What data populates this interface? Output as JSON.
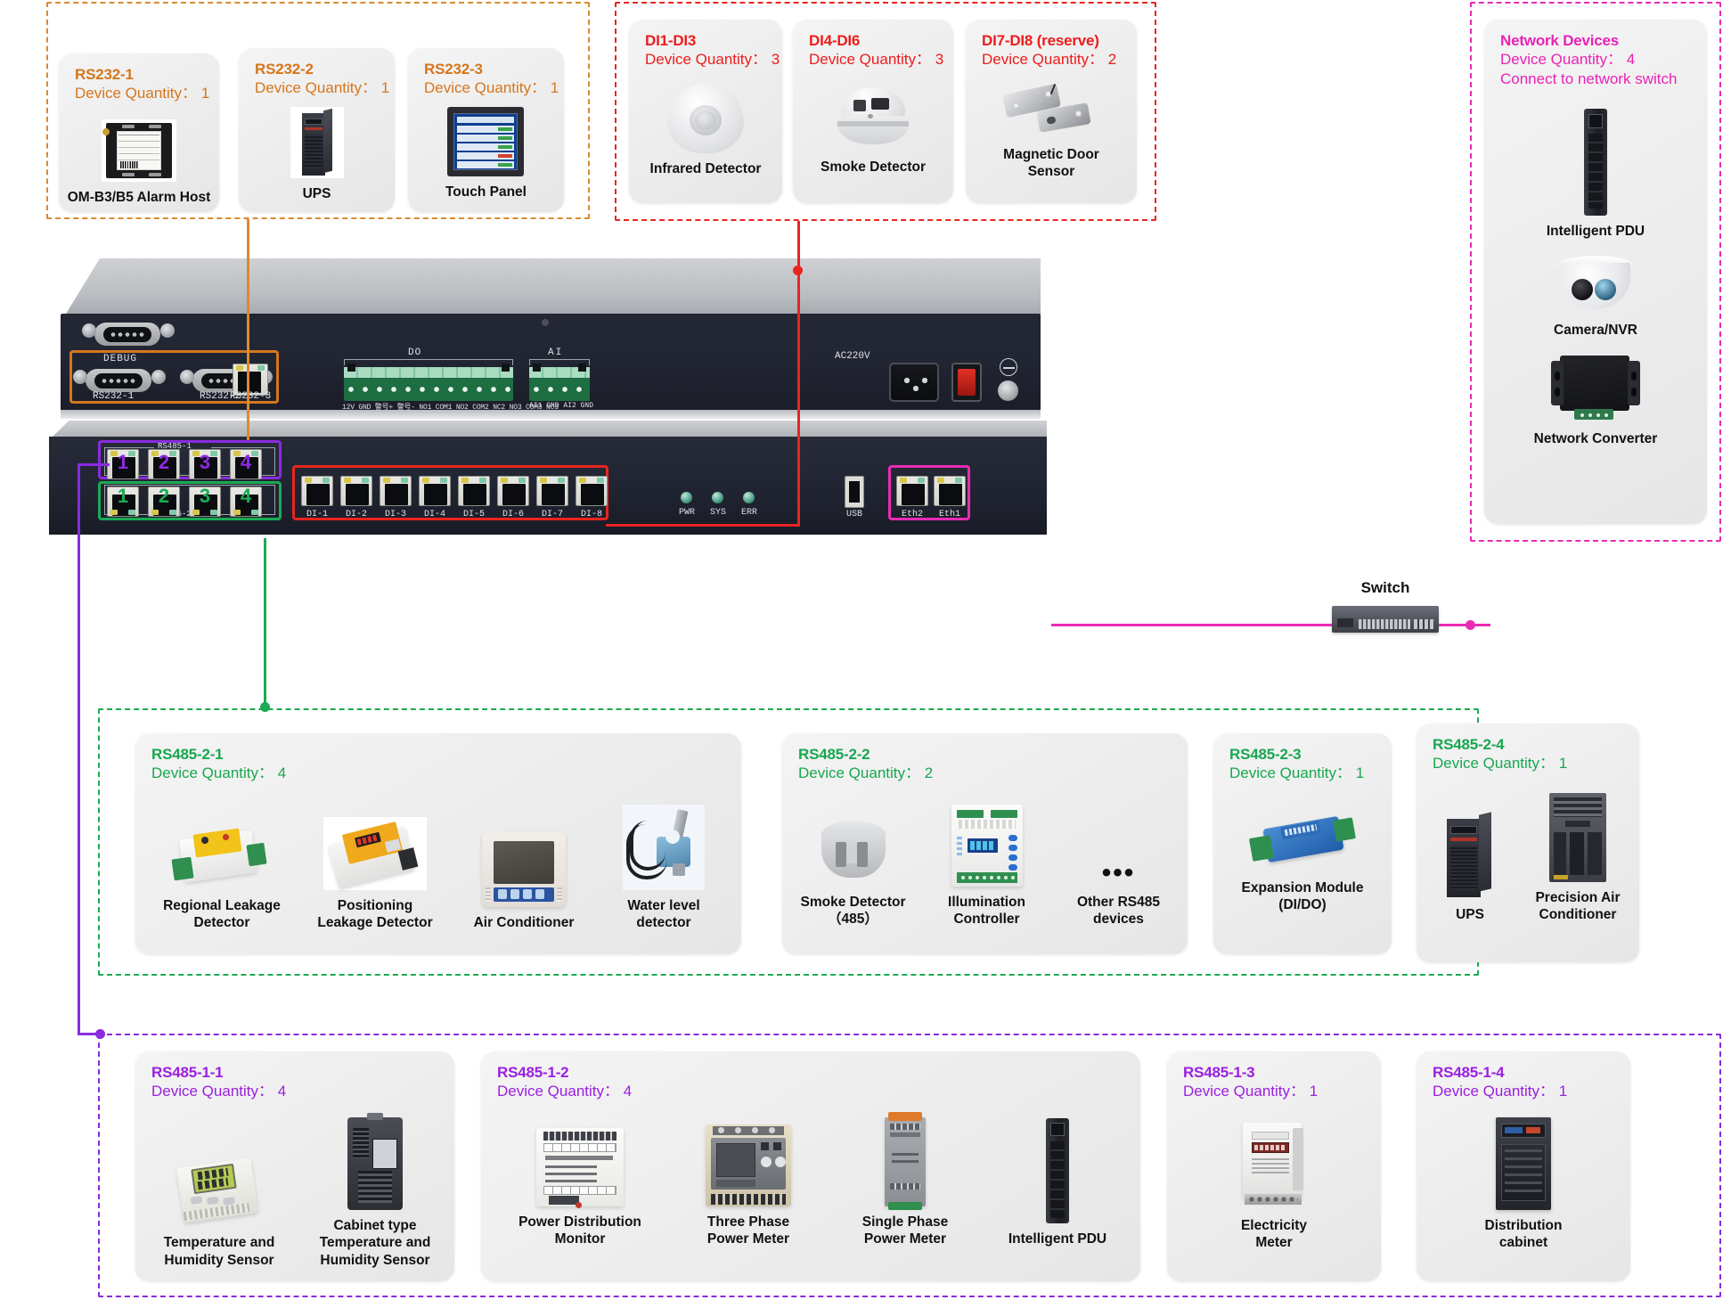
{
  "groups": {
    "rs232": {
      "color": "#d5761d"
    },
    "di": {
      "color": "#ee1c1c"
    },
    "network": {
      "color": "#ea22b6"
    },
    "rs485_2": {
      "color": "#17a74f"
    },
    "rs485_1": {
      "color": "#9b1fe0"
    }
  },
  "qty_label": "Device Quantity：",
  "rs232_cards": [
    {
      "title": "RS232-1",
      "qty": "Device Quantity： 1",
      "items": [
        {
          "label": "OM-B3/B5 Alarm Host",
          "icon": "alarm-host-image"
        }
      ]
    },
    {
      "title": "RS232-2",
      "qty": "Device Quantity： 1",
      "items": [
        {
          "label": "UPS",
          "icon": "ups-image"
        }
      ]
    },
    {
      "title": "RS232-3",
      "qty": "Device Quantity： 1",
      "items": [
        {
          "label": "Touch  Panel",
          "icon": "touch-panel-image"
        }
      ]
    }
  ],
  "di_cards": [
    {
      "title": "DI1-DI3",
      "qty": "Device Quantity： 3",
      "items": [
        {
          "label": "Infrared Detector",
          "icon": "infrared-detector-image"
        }
      ]
    },
    {
      "title": "DI4-DI6",
      "qty": "Device Quantity： 3",
      "items": [
        {
          "label": "Smoke Detector",
          "icon": "smoke-detector-image"
        }
      ]
    },
    {
      "title": "DI7-DI8 (reserve)",
      "qty": "Device Quantity： 2",
      "items": [
        {
          "label": "Magnetic Door\nSensor",
          "icon": "magnetic-door-sensor-image"
        }
      ]
    }
  ],
  "network_card": {
    "title": "Network Devices",
    "qty": "Device Quantity： 4",
    "note": "Connect to network switch",
    "items": [
      {
        "label": "Intelligent PDU",
        "icon": "intelligent-pdu-image"
      },
      {
        "label": "Camera/NVR",
        "icon": "camera-nvr-image"
      },
      {
        "label": "Network Converter",
        "icon": "network-converter-image"
      }
    ]
  },
  "switch": {
    "label": "Switch",
    "icon": "network-switch-image"
  },
  "rs485_2_cards": [
    {
      "title": "RS485-2-1",
      "qty": "Device Quantity： 4",
      "items": [
        {
          "label": "Regional Leakage\nDetector",
          "icon": "regional-leakage-detector-image"
        },
        {
          "label": "Positioning\nLeakage Detector",
          "icon": "positioning-leakage-detector-image"
        },
        {
          "label": "Air Conditioner",
          "icon": "air-conditioner-image"
        },
        {
          "label": "Water level\ndetector",
          "icon": "water-level-detector-image"
        }
      ]
    },
    {
      "title": "RS485-2-2",
      "qty": "Device Quantity： 2",
      "items": [
        {
          "label": "Smoke Detector\n（485）",
          "icon": "smoke-detector-485-image"
        },
        {
          "label": "Illumination\nController",
          "icon": "illumination-controller-image"
        },
        {
          "label": "Other RS485\ndevices",
          "icon": "ellipsis-icon"
        }
      ]
    },
    {
      "title": "RS485-2-3",
      "qty": "Device Quantity： 1",
      "items": [
        {
          "label": "Expansion Module\n(DI/DO)",
          "icon": "expansion-module-image"
        }
      ]
    },
    {
      "title": "RS485-2-4",
      "qty": "Device Quantity： 1",
      "items": [
        {
          "label": "UPS",
          "icon": "ups-image"
        },
        {
          "label": "Precision Air\nConditioner",
          "icon": "precision-air-conditioner-image"
        }
      ]
    }
  ],
  "rs485_1_cards": [
    {
      "title": "RS485-1-1",
      "qty": "Device Quantity： 4",
      "items": [
        {
          "label": "Temperature and\nHumidity Sensor",
          "icon": "temperature-humidity-sensor-image"
        },
        {
          "label": "Cabinet type\nTemperature and\nHumidity Sensor",
          "icon": "cabinet-temperature-humidity-sensor-image"
        }
      ]
    },
    {
      "title": "RS485-1-2",
      "qty": "Device Quantity： 4",
      "items": [
        {
          "label": "Power Distribution\nMonitor",
          "icon": "power-distribution-monitor-image"
        },
        {
          "label": "Three Phase\nPower Meter",
          "icon": "three-phase-power-meter-image"
        },
        {
          "label": "Single Phase\nPower Meter",
          "icon": "single-phase-power-meter-image"
        },
        {
          "label": "Intelligent PDU",
          "icon": "intelligent-pdu-image"
        }
      ]
    },
    {
      "title": "RS485-1-3",
      "qty": "Device Quantity： 1",
      "items": [
        {
          "label": "Electricity\nMeter",
          "icon": "electricity-meter-image"
        }
      ]
    },
    {
      "title": "RS485-1-4",
      "qty": "Device Quantity： 1",
      "items": [
        {
          "label": "Distribution\ncabinet",
          "icon": "distribution-cabinet-image"
        }
      ]
    }
  ],
  "rear_panel": {
    "debug_label": "DEBUG",
    "rs232_1": "RS232-1",
    "rs232_2": "RS232-2",
    "rs232_3": "RS232-3",
    "do_label": "DO",
    "ai_label": "AI",
    "do_pins": "12V  GND  警号+ 警号- NO1 COM1 NO2 COM2 NC2  NO3 COM3 NC3",
    "ai_pins": "AI1  GND  AI2  GND",
    "ac_label": "AC220V"
  },
  "front_panel": {
    "rs485_1_label": "RS485-1",
    "rs485_2_label": "RS485-2",
    "rs485_1_ports": [
      "1",
      "2",
      "3",
      "4"
    ],
    "rs485_2_ports": [
      "1",
      "2",
      "3",
      "4"
    ],
    "di_ports": [
      "DI-1",
      "DI-2",
      "DI-3",
      "DI-4",
      "DI-5",
      "DI-6",
      "DI-7",
      "DI-8"
    ],
    "leds": [
      "PWR",
      "SYS",
      "ERR"
    ],
    "usb_label": "USB",
    "eth_ports": [
      "Eth2",
      "Eth1"
    ]
  }
}
